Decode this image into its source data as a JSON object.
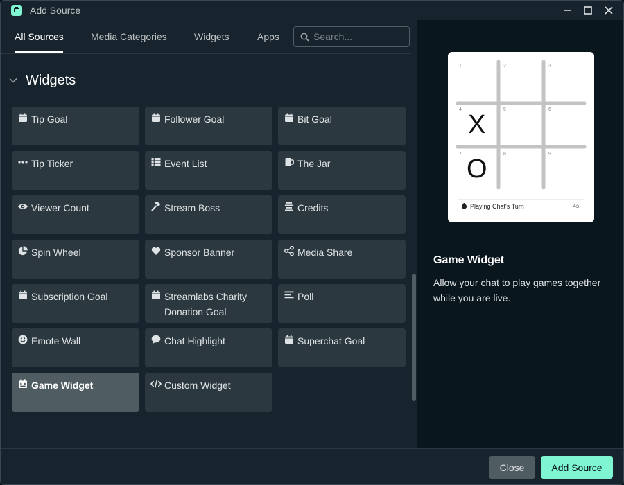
{
  "window": {
    "title": "Add Source"
  },
  "tabs": [
    {
      "label": "All Sources",
      "active": true
    },
    {
      "label": "Media Categories",
      "active": false
    },
    {
      "label": "Widgets",
      "active": false
    },
    {
      "label": "Apps",
      "active": false
    }
  ],
  "search": {
    "placeholder": "Search..."
  },
  "section": {
    "title": "Widgets"
  },
  "widgets": [
    {
      "label": "Tip Goal",
      "icon": "calendar-icon"
    },
    {
      "label": "Follower Goal",
      "icon": "calendar-icon"
    },
    {
      "label": "Bit Goal",
      "icon": "calendar-icon"
    },
    {
      "label": "Tip Ticker",
      "icon": "ellipsis-icon"
    },
    {
      "label": "Event List",
      "icon": "list-icon"
    },
    {
      "label": "The Jar",
      "icon": "jar-icon"
    },
    {
      "label": "Viewer Count",
      "icon": "eye-icon"
    },
    {
      "label": "Stream Boss",
      "icon": "hammer-icon"
    },
    {
      "label": "Credits",
      "icon": "align-center-icon"
    },
    {
      "label": "Spin Wheel",
      "icon": "pie-icon"
    },
    {
      "label": "Sponsor Banner",
      "icon": "heart-icon"
    },
    {
      "label": "Media Share",
      "icon": "share-icon"
    },
    {
      "label": "Subscription Goal",
      "icon": "calendar-icon"
    },
    {
      "label": "Streamlabs Charity Donation Goal",
      "icon": "calendar-icon"
    },
    {
      "label": "Poll",
      "icon": "align-left-icon"
    },
    {
      "label": "Emote Wall",
      "icon": "smile-icon"
    },
    {
      "label": "Chat Highlight",
      "icon": "chat-bubble-icon"
    },
    {
      "label": "Superchat Goal",
      "icon": "calendar-icon"
    },
    {
      "label": "Game Widget",
      "icon": "game-icon",
      "selected": true
    },
    {
      "label": "Custom Widget",
      "icon": "code-icon"
    }
  ],
  "preview": {
    "grid_numbers": [
      "1",
      "2",
      "3",
      "4",
      "5",
      "6",
      "7",
      "8",
      "9"
    ],
    "marks": [
      "X",
      "O"
    ],
    "status_text": "Playing Chat's Turn",
    "status_time": "4s"
  },
  "detail": {
    "title": "Game Widget",
    "description": "Allow your chat to play games together while you are live."
  },
  "footer": {
    "close_label": "Close",
    "add_label": "Add Source"
  },
  "colors": {
    "accent": "#80f5d2",
    "panel": "#17242d",
    "background": "#09161d",
    "card": "#2b383f",
    "card_selected": "#4f5d63"
  }
}
